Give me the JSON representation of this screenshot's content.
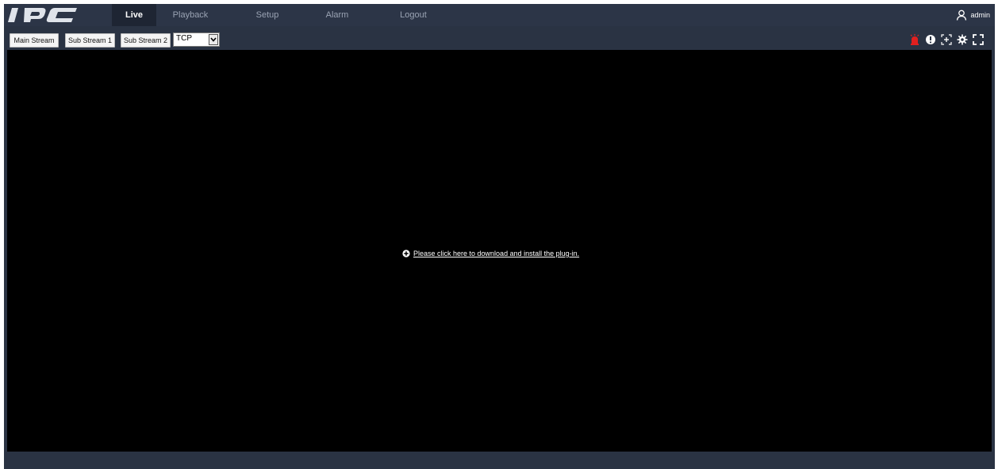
{
  "brand": {
    "logo_text": "IPC"
  },
  "nav": {
    "items": [
      {
        "label": "Live",
        "active": true
      },
      {
        "label": "Playback",
        "active": false
      },
      {
        "label": "Setup",
        "active": false
      },
      {
        "label": "Alarm",
        "active": false
      },
      {
        "label": "Logout",
        "active": false
      }
    ]
  },
  "user": {
    "name": "admin",
    "icon": "user-icon"
  },
  "toolbar": {
    "main_stream": "Main Stream",
    "sub_stream_1": "Sub Stream 1",
    "sub_stream_2": "Sub Stream 2",
    "protocol": "TCP",
    "icons": [
      "alarm-icon",
      "info-icon",
      "zoom-icon",
      "settings-icon",
      "fullscreen-icon"
    ]
  },
  "video": {
    "plugin_message": "Please click here to download and install the plug-in.",
    "plugin_icon": "plus-circle-icon"
  },
  "colors": {
    "nav_bg": "#2c3547",
    "active_nav_bg": "#1e2533",
    "video_bg": "#000000",
    "alarm": "#e0201f"
  }
}
